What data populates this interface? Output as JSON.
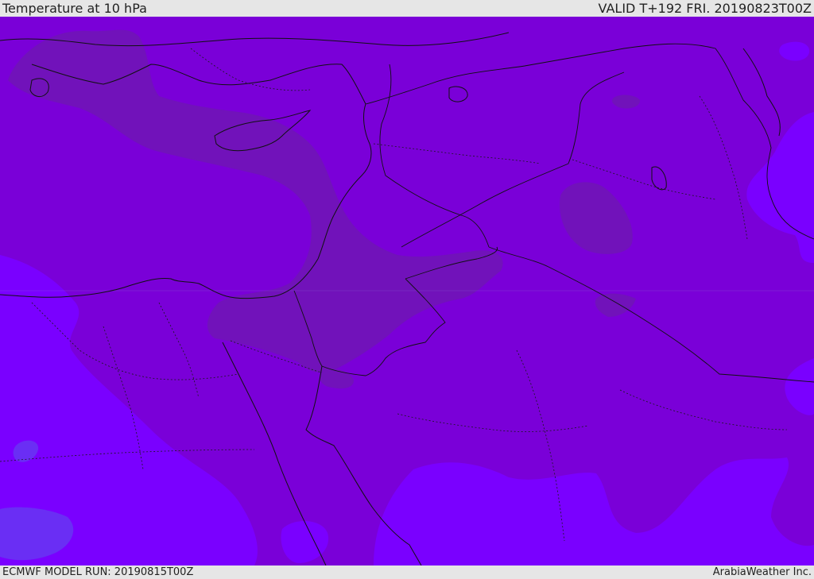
{
  "header": {
    "title": "Temperature at 10 hPa",
    "valid": "VALID T+192 FRI. 20190823T00Z"
  },
  "footer": {
    "model_run": "ECMWF MODEL RUN: 20190815T00Z",
    "credit": "ArabiaWeather Inc."
  },
  "colors": {
    "base_field": "#7a00d8",
    "warm_field": "#7010b8",
    "cool_field": "#7a00ff",
    "cooler_field": "#6f20f0",
    "coastline": "#111111",
    "frame": "#e6e6e6"
  }
}
